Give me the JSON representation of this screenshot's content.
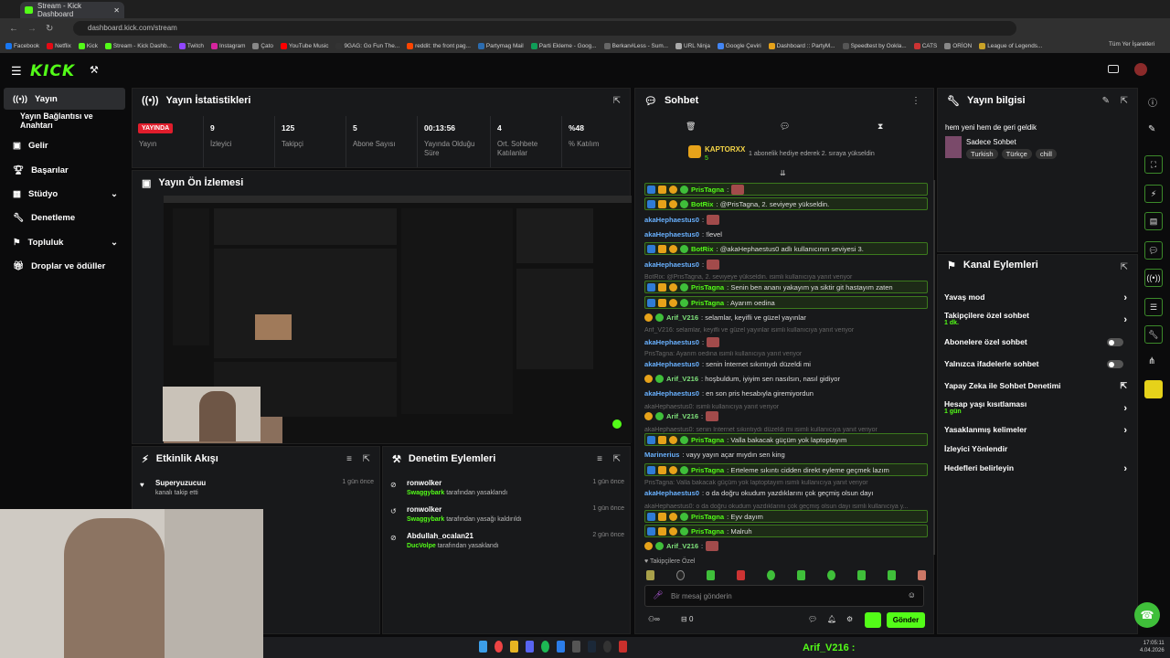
{
  "browser": {
    "tab_title": "Stream - Kick Dashboard",
    "url": "dashboard.kick.com/stream",
    "bookmarks": [
      "Facebook",
      "Netflix",
      "Kick",
      "Stream - Kick Dashb...",
      "Twitch",
      "Instagram",
      "Çato",
      "YouTube Music",
      "9GAG: Go Fun The...",
      "reddit: the front pag...",
      "Partymag Mail",
      "Parti Ekleme - Goog...",
      "Berkan#Less - Sum...",
      "URL Ninja",
      "Google Çeviri",
      "Dashboard :: PartyM...",
      "Speedtest by Ookla...",
      "CATS",
      "ORİON",
      "League of Legends..."
    ],
    "all_bookmarks": "Tüm Yer İşaretleri"
  },
  "brand": {
    "logo": "KICK",
    "accent": "#53fc18"
  },
  "sidebar": {
    "items": [
      {
        "label": "Yayın"
      },
      {
        "label": "Yayın Bağlantısı ve Anahtarı"
      },
      {
        "label": "Gelir"
      },
      {
        "label": "Başarılar"
      },
      {
        "label": "Stüdyo"
      },
      {
        "label": "Denetleme"
      },
      {
        "label": "Topluluk"
      },
      {
        "label": "Droplar ve ödüller"
      }
    ]
  },
  "stats": {
    "title": "Yayın İstatistikleri",
    "live_badge": "YAYINDA",
    "live_label": "Yayın",
    "items": [
      {
        "value": "9",
        "label": "İzleyici"
      },
      {
        "value": "125",
        "label": "Takipçi"
      },
      {
        "value": "5",
        "label": "Abone Sayısı"
      },
      {
        "value": "00:13:56",
        "label": "Yayında Olduğu Süre"
      },
      {
        "value": "4",
        "label": "Ort. Sohbete Katılanlar"
      },
      {
        "value": "%48",
        "label": "% Katılım"
      }
    ]
  },
  "preview": {
    "title": "Yayın Ön İzlemesi"
  },
  "activity": {
    "title": "Etkinlik Akışı",
    "items": [
      {
        "name": "Superyuzucuu",
        "desc": "kanalı takip etti",
        "time": "1 gün önce"
      }
    ]
  },
  "moderation": {
    "title": "Denetim Eylemleri",
    "items": [
      {
        "name": "ronwolker",
        "by": "Swaggybark",
        "desc": "tarafından yasaklandı",
        "time": "1 gün önce"
      },
      {
        "name": "ronwolker",
        "by": "Swaggybark",
        "desc": "tarafından yasağı kaldırıldı",
        "time": "1 gün önce"
      },
      {
        "name": "Abdullah_ocalan21",
        "by": "DucVolpe",
        "desc": "tarafından yasaklandı",
        "time": "2 gün önce"
      }
    ]
  },
  "chat": {
    "title": "Sohbet",
    "pinned_user": "KAPTORXX",
    "pinned_count": "5",
    "pinned_text": "1 abonelik hediye ederek 2. sıraya yükseldin",
    "messages": [
      {
        "user": "PrisTagna",
        "text": ":",
        "style": "hl"
      },
      {
        "user": "BotRix",
        "text": ": @PrisTagna, 2. seviyeye yükseldin.",
        "style": "hl"
      },
      {
        "user": "akaHephaestus0",
        "text": ":"
      },
      {
        "user": "akaHephaestus0",
        "text": ": !level"
      },
      {
        "user": "BotRix",
        "text": ": @akaHephaestus0 adlı kullanıcının seviyesi 3.",
        "style": "hl"
      },
      {
        "user": "akaHephaestus0",
        "text": ":"
      },
      {
        "reply": "BotRix: @PrisTagna, 2. seviyeye yükseldin. isimli kullanıcıya yanıt veriyor"
      },
      {
        "user": "PrisTagna",
        "text": ": Senin ben ananı yakayım ya siktir git hastayım zaten",
        "style": "hl"
      },
      {
        "user": "PrisTagna",
        "text": ": Ayarım oedina",
        "style": "hl"
      },
      {
        "user": "Arif_V216",
        "text": ": selamlar, keyifli ve güzel yayınlar"
      },
      {
        "reply": "Arif_V216: selamlar, keyifli ve güzel yayınlar isimli kullanıcıya yanıt veriyor"
      },
      {
        "user": "akaHephaestus0",
        "text": ":"
      },
      {
        "reply": "PrisTagna: Ayarım oedina isimli kullanıcıya yanıt veriyor"
      },
      {
        "user": "akaHephaestus0",
        "text": ": senin İnternet sıkıntıydı düzeldi mi"
      },
      {
        "user": "Arif_V216",
        "text": ": hoşbuldum, iyiyim sen nasılsın, nasıl gidiyor"
      },
      {
        "user": "akaHephaestus0",
        "text": ": en son pris hesabıyla giremiyordun"
      },
      {
        "reply": "akaHephaestus0: isimli kullanıcıya yanıt veriyor"
      },
      {
        "user": "Arif_V216",
        "text": ":"
      },
      {
        "reply": "akaHephaestus0: senin İnternet sıkıntıydı düzeldi mi isimli kullanıcıya yanıt veriyor"
      },
      {
        "user": "PrisTagna",
        "text": ": Valla bakacak güçüm yok laptoptayım",
        "style": "hl"
      },
      {
        "user": "Marinerius",
        "text": ": vayy yayın açar mıydın sen king"
      },
      {
        "user": "PrisTagna",
        "text": ": Erteleme sıkıntı cidden direkt eyleme geçmek lazım",
        "style": "hl"
      },
      {
        "reply": "PrisTagna: Valla bakacak güçüm yok laptoptayım isimli kullanıcıya yanıt veriyor"
      },
      {
        "user": "akaHephaestus0",
        "text": ": o da doğru okudum yazdıklarını çok geçmiş olsun dayı"
      },
      {
        "reply": "akaHephaestus0: o da doğru okudum yazdıklarını çok geçmiş olsun dayı isimli kullanıcıya y..."
      },
      {
        "user": "PrisTagna",
        "text": ": Eyv dayım",
        "style": "hl"
      },
      {
        "user": "PrisTagna",
        "text": ": Malruh",
        "style": "hl"
      },
      {
        "user": "Arif_V216",
        "text": ":"
      }
    ],
    "followers_only": "Takipçilere Özel",
    "input_placeholder": "Bir mesaj gönderin",
    "viewer_count": "0",
    "send_label": "Gönder"
  },
  "stream_info": {
    "title": "Yayın bilgisi",
    "stream_title": "hem yeni hem de geri geldik",
    "category": "Sadece Sohbet",
    "tags": [
      "Turkish",
      "Türkçe",
      "chill"
    ]
  },
  "channel_actions": {
    "title": "Kanal Eylemleri",
    "items": [
      {
        "label": "Yavaş mod",
        "control": "chevron"
      },
      {
        "label": "Takipçilere özel sohbet",
        "sub": "1 dk.",
        "control": "chevron"
      },
      {
        "label": "Abonelere özel sohbet",
        "control": "toggle"
      },
      {
        "label": "Yalnızca ifadelerle sohbet",
        "control": "toggle"
      },
      {
        "label": "Yapay Zeka ile Sohbet Denetimi",
        "control": "external"
      },
      {
        "label": "Hesap yaşı kısıtlaması",
        "sub": "1 gün",
        "control": "chevron"
      },
      {
        "label": "Yasaklanmış kelimeler",
        "control": "chevron"
      },
      {
        "label": "İzleyici Yönlendir",
        "control": "none"
      },
      {
        "label": "Hedefleri belirleyin",
        "control": "chevron"
      }
    ]
  },
  "taskbar": {
    "overlay_name": "Arif_V216 :",
    "time": "17:05:11",
    "date": "4.04.2026"
  }
}
